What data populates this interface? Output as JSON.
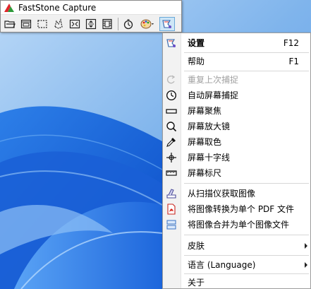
{
  "toolbar": {
    "title": "FastStone Capture",
    "tools": [
      {
        "icon": "open-folder-icon"
      },
      {
        "icon": "capture-window-icon"
      },
      {
        "icon": "capture-rectangle-icon"
      },
      {
        "icon": "capture-freehand-icon"
      },
      {
        "icon": "capture-fullscreen-icon"
      },
      {
        "icon": "capture-scrolling-icon"
      },
      {
        "icon": "capture-video-icon"
      },
      {
        "icon": "timer-icon"
      },
      {
        "icon": "output-palette-icon"
      },
      {
        "icon": "main-menu-icon"
      }
    ]
  },
  "menu": {
    "items": [
      {
        "label": "设置",
        "shortcut": "F12",
        "icon": "settings-icon",
        "bold": true
      },
      {
        "label": "帮助",
        "shortcut": "F1",
        "icon": null
      },
      {
        "label": "重复上次捕捉",
        "icon": "repeat-capture-icon",
        "disabled": true
      },
      {
        "label": "自动屏幕捕捉",
        "icon": "clock-icon"
      },
      {
        "label": "屏幕聚焦",
        "icon": "focus-bar-icon"
      },
      {
        "label": "屏幕放大镜",
        "icon": "magnifier-icon"
      },
      {
        "label": "屏幕取色",
        "icon": "color-picker-icon"
      },
      {
        "label": "屏幕十字线",
        "icon": "crosshair-icon"
      },
      {
        "label": "屏幕标尺",
        "icon": "ruler-icon"
      },
      {
        "label": "从扫描仪获取图像",
        "icon": "scanner-icon"
      },
      {
        "label": "将图像转换为单个 PDF 文件",
        "icon": "pdf-icon"
      },
      {
        "label": "将图像合并为单个图像文件",
        "icon": "combine-images-icon"
      },
      {
        "label": "皮肤",
        "icon": null,
        "submenu": true
      },
      {
        "label": "语言 (Language)",
        "icon": null,
        "submenu": true
      },
      {
        "label": "关于",
        "icon": null
      }
    ]
  },
  "colors": {
    "accent": "#0078d4",
    "wallpaper": "#7fb6ee"
  }
}
